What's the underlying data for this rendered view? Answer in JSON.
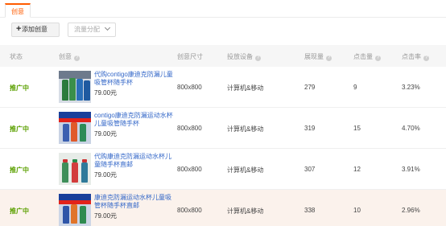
{
  "tabs": [
    {
      "label": "创意"
    }
  ],
  "toolbar": {
    "add_label": "添加创意",
    "add_icon": "plus-icon",
    "alloc_placeholder": "流量分配"
  },
  "table": {
    "headers": {
      "status": "状态",
      "creative": "创意",
      "size": "创意尺寸",
      "device": "投放设备",
      "impressions": "展现量",
      "clicks": "点击量",
      "ctr": "点击率"
    },
    "rows": [
      {
        "status": "推广中",
        "title": "代购contigo康迪克防漏儿童吸管杯随手杯",
        "price": "79.00元",
        "size": "800x800",
        "device": "计算机&移动",
        "impressions": "279",
        "clicks": "9",
        "ctr": "3.23%"
      },
      {
        "status": "推广中",
        "title": "contigo康迪克防漏运动水杯儿童吸管随手杯",
        "price": "79.00元",
        "size": "800x800",
        "device": "计算机&移动",
        "impressions": "319",
        "clicks": "15",
        "ctr": "4.70%"
      },
      {
        "status": "推广中",
        "title": "代购康迪克防漏运动水杯儿童随手杯直邮",
        "price": "79.00元",
        "size": "800x800",
        "device": "计算机&移动",
        "impressions": "307",
        "clicks": "12",
        "ctr": "3.91%"
      },
      {
        "status": "推广中",
        "title": "康迪克防漏运动水杯儿童吸管杯随手杯直邮",
        "price": "79.00元",
        "size": "800x800",
        "device": "计算机&移动",
        "impressions": "338",
        "clicks": "10",
        "ctr": "2.96%"
      }
    ]
  },
  "colors": {
    "accent": "#ff5b00",
    "link": "#3367c8",
    "status": "#5ba000",
    "highlight_row": "#fbf2ec"
  }
}
